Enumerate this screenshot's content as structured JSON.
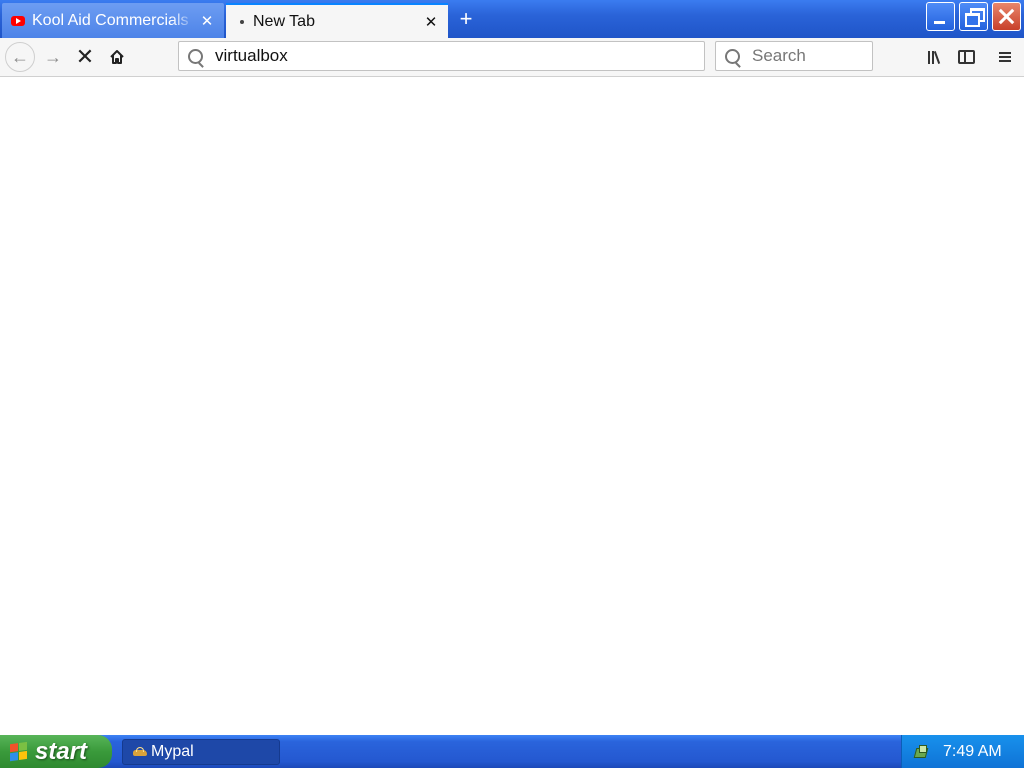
{
  "tabs": [
    {
      "title": "Kool Aid Commercials",
      "icon": "youtube-icon",
      "active": false
    },
    {
      "title": "New Tab",
      "icon": "loading-icon",
      "active": true
    }
  ],
  "window_controls": [
    "minimize-icon",
    "restore-icon",
    "close-icon"
  ],
  "navigation": {
    "back": "back-arrow-icon",
    "forward": "forward-arrow-icon",
    "stop": "stop-icon",
    "home": "home-icon"
  },
  "urlbar": {
    "value": "virtualbox"
  },
  "searchbar": {
    "placeholder": "Search"
  },
  "toolbar_icons": [
    "library-icon",
    "sidebar-icon",
    "hamburger-menu-icon"
  ],
  "taskbar": {
    "start_label": "start",
    "items": [
      {
        "label": "Mypal",
        "icon": "mypal-icon"
      }
    ],
    "clock": "7:49 AM"
  },
  "colors": {
    "titlebar": "#2a63d8",
    "tab_accent": "#0a84ff",
    "start_green": "#3a9a3b",
    "taskbar_blue": "#2458d0",
    "tray_blue": "#0f73d6"
  }
}
